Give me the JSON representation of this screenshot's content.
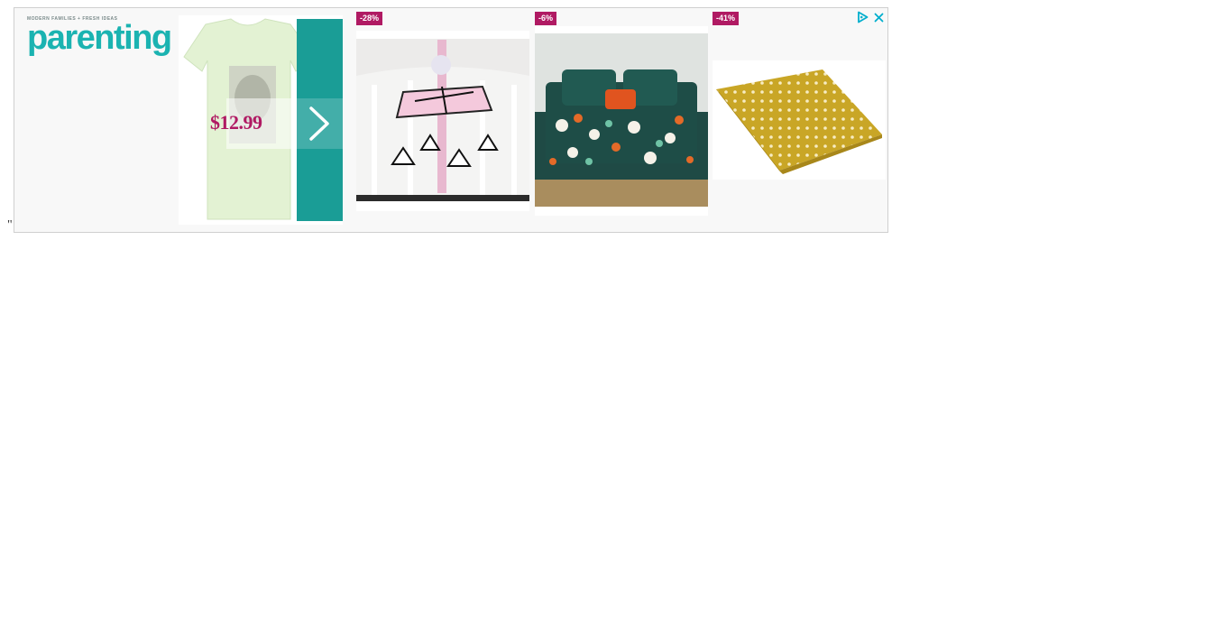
{
  "stray_text": "\"",
  "ad": {
    "brand": {
      "tagline": "Modern Families + Fresh Ideas",
      "name": "parenting"
    },
    "featured": {
      "price": "$12.99",
      "next_icon": "chevron-right-icon"
    },
    "controls": {
      "adchoices_icon": "adchoices-icon",
      "close_icon": "close-icon"
    },
    "products": [
      {
        "badge": "-28%",
        "image": "crib-mobile"
      },
      {
        "badge": "-6%",
        "image": "floral-quilt-set"
      },
      {
        "badge": "-41%",
        "image": "polka-dot-sheet"
      }
    ],
    "colors": {
      "brand": "#1bb3b1",
      "badge": "#b01a63",
      "price": "#b01a63",
      "next_button": "#1a9d96"
    }
  }
}
